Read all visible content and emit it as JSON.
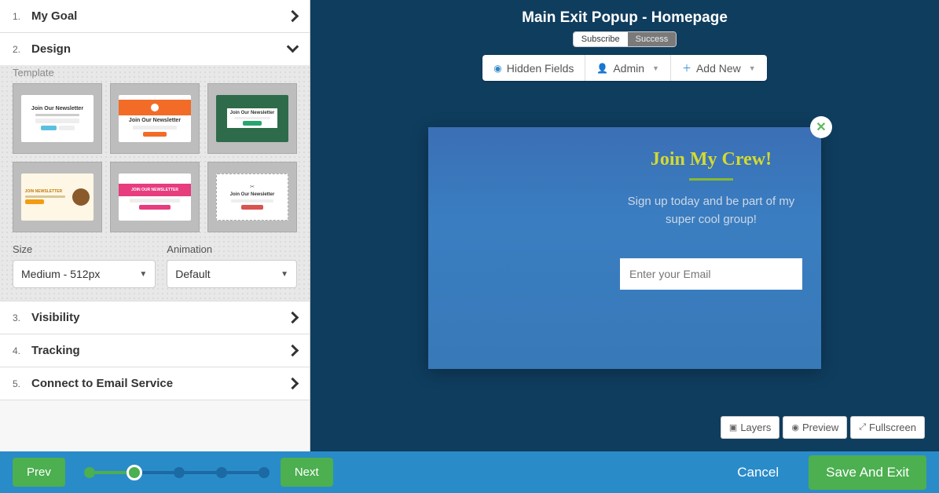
{
  "sidebar": {
    "steps": [
      {
        "num": "1.",
        "title": "My Goal"
      },
      {
        "num": "2.",
        "title": "Design"
      },
      {
        "num": "3.",
        "title": "Visibility"
      },
      {
        "num": "4.",
        "title": "Tracking"
      },
      {
        "num": "5.",
        "title": "Connect to Email Service"
      }
    ],
    "design": {
      "template_label": "Template",
      "size_label": "Size",
      "size_value": "Medium - 512px",
      "animation_label": "Animation",
      "animation_value": "Default"
    }
  },
  "canvas": {
    "title": "Main Exit Popup - Homepage",
    "tabs": {
      "subscribe": "Subscribe",
      "success": "Success"
    },
    "toolbar": {
      "hidden_fields": "Hidden Fields",
      "admin": "Admin",
      "add_new": "Add New"
    },
    "popup": {
      "heading": "Join My Crew!",
      "sub": "Sign up today and be part of my super cool group!",
      "placeholder": "Enter your Email"
    },
    "floating": {
      "layers": "Layers",
      "preview": "Preview",
      "fullscreen": "Fullscreen"
    }
  },
  "footer": {
    "prev": "Prev",
    "next": "Next",
    "cancel": "Cancel",
    "save": "Save And Exit"
  }
}
